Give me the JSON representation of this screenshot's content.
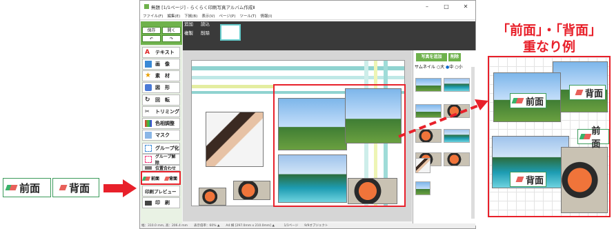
{
  "legend": {
    "front_label": "前面",
    "back_label": "背面"
  },
  "window": {
    "title": "無題 [1/1ページ] - らくらく印刷写真アルバム作成Ⅱ",
    "menu": [
      "ファイル(F)",
      "編集(E)",
      "下揃(B)",
      "表示(V)",
      "ページ(P)",
      "ツール(T)",
      "情報(I)"
    ],
    "top_controls": {
      "save": "保存",
      "open": "開く",
      "undo": "↶",
      "redo": "↷"
    },
    "page_controls": {
      "add": "追加",
      "read": "読込",
      "copy": "複製",
      "delete": "削除"
    },
    "tools": [
      {
        "label": "テキスト",
        "icon": "text-icon"
      },
      {
        "label": "画　像",
        "icon": "image-icon"
      },
      {
        "label": "素　材",
        "icon": "star-icon"
      },
      {
        "label": "図　形",
        "icon": "shape-icon"
      },
      {
        "label": "回　転",
        "icon": "rotate-icon"
      },
      {
        "label": "トリミング",
        "icon": "trim-icon"
      },
      {
        "label": "色相調整",
        "icon": "color-icon"
      },
      {
        "label": "マスク",
        "icon": "mask-icon"
      },
      {
        "label": "グループ化",
        "icon": "group-icon"
      },
      {
        "label": "グループ解除",
        "icon": "ungroup-icon"
      },
      {
        "label": "位置合わせ",
        "icon": "align-icon"
      }
    ],
    "front_btn": "前面",
    "back_btn": "背面",
    "print_preview": "印刷プレビュー",
    "print": "印　刷",
    "right_panel": {
      "add_photo": "写真を追加",
      "delete": "削除",
      "thumb_label": "サムネイル",
      "size_options": [
        "大",
        "中",
        "小"
      ],
      "selected_size": "中"
    },
    "status": "幅：310.0 mm, 高：206.4 mm　　表示倍率：60% ▲　　A4 横 [297.0mm x 210.0mm] ▲　　　1/1ページ　　9/9オブジェクト",
    "colors": {
      "green": "#6fb24c",
      "red": "#e8202a"
    }
  },
  "annotation": {
    "title_line1": "「前面」・「背面」",
    "title_line2": "重なり例",
    "labels": [
      "前面",
      "背面",
      "前面",
      "背面"
    ]
  }
}
